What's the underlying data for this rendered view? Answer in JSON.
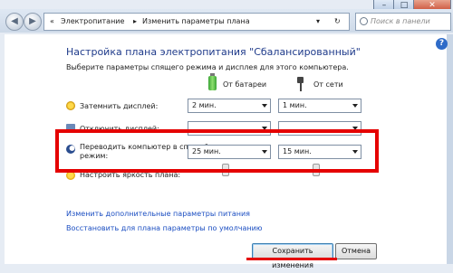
{
  "window": {
    "min": "–",
    "max": "□",
    "close": "✕"
  },
  "address": {
    "back": "◀",
    "forward": "▶",
    "breadcrumbs": [
      "«",
      "Электропитание",
      "▸",
      "Изменить параметры плана"
    ],
    "dropdown": "▾",
    "refresh": "↻",
    "search_placeholder": "Поиск в панели управлен"
  },
  "help": "?",
  "header": {
    "title": "Настройка плана электропитания \"Сбалансированный\"",
    "subtitle": "Выберите параметры спящего режима и дисплея для этого компьютера."
  },
  "columns": {
    "battery": "От батареи",
    "ac": "От сети"
  },
  "rows": {
    "dim": {
      "label": "Затемнить дисплей:",
      "battery": "2 мин.",
      "ac": "1 мин."
    },
    "off": {
      "label": "Отключить дисплей:",
      "battery": "",
      "ac": ""
    },
    "sleep": {
      "label_line1": "Переводить компьютер в спящий",
      "label_line2": "режим:",
      "battery": "25 мин.",
      "ac": "15 мин."
    },
    "brightness": {
      "label": "Настроить яркость плана:"
    }
  },
  "links": {
    "advanced": "Изменить дополнительные параметры питания",
    "restore": "Восстановить для плана параметры по умолчанию"
  },
  "buttons": {
    "save": "Сохранить изменения",
    "cancel": "Отмена"
  },
  "colors": {
    "highlight": "#e50000",
    "title": "#1e3a8a",
    "link": "#1c4fc2"
  }
}
